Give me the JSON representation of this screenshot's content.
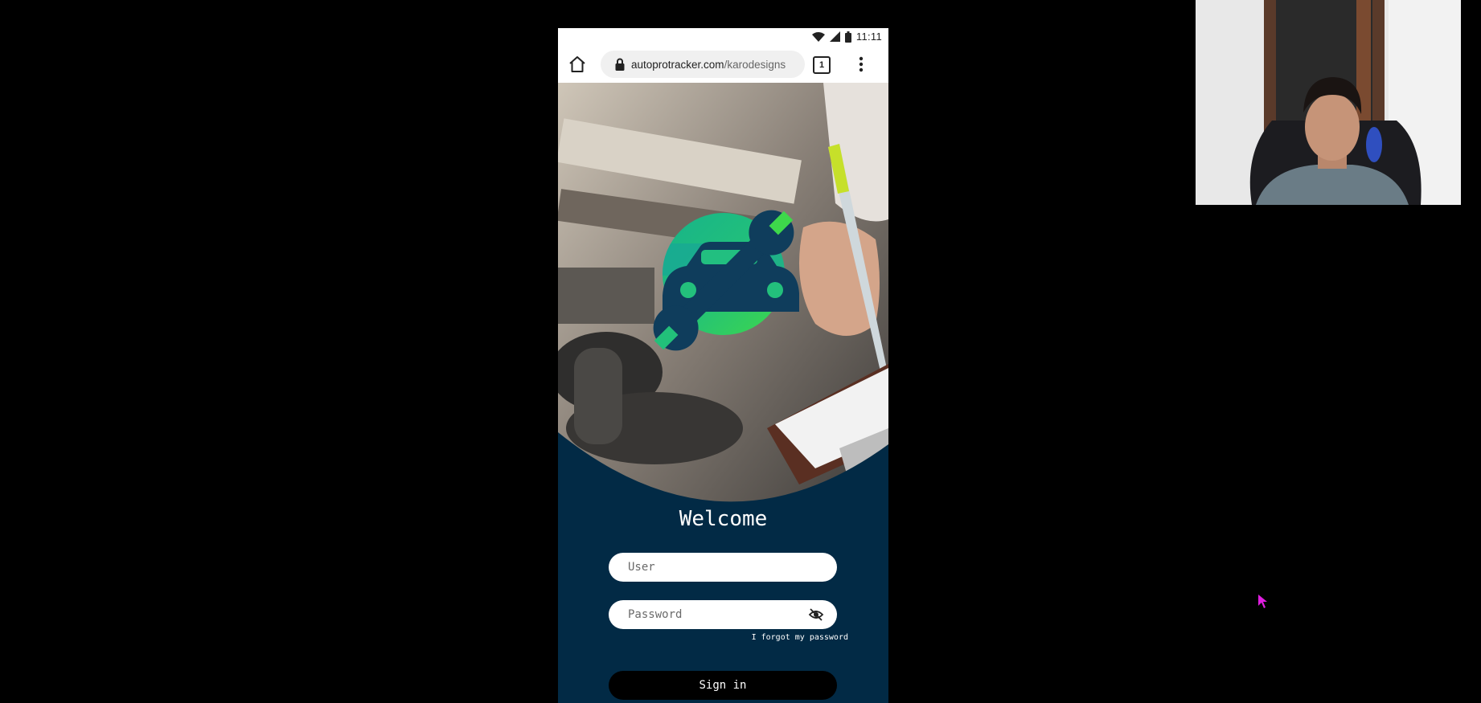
{
  "status_bar": {
    "time": "11:11",
    "icons": [
      "wifi-icon",
      "signal-icon",
      "battery-icon"
    ]
  },
  "browser": {
    "url_domain": "autoprotracker.com",
    "url_path": "/karodesigns",
    "tab_count": "1",
    "icons": [
      "home-icon",
      "lock-icon",
      "tabs-icon",
      "more-vert-icon"
    ]
  },
  "login": {
    "title": "Welcome",
    "user_placeholder": "User",
    "password_placeholder": "Password",
    "forgot_label": "I forgot my password",
    "signin_label": "Sign in"
  },
  "colors": {
    "panel": "#022a45",
    "logo_green": "#2ecc71",
    "logo_teal": "#1fa98c",
    "logo_dark": "#0f3d5c",
    "cursor": "#e01ee0"
  }
}
